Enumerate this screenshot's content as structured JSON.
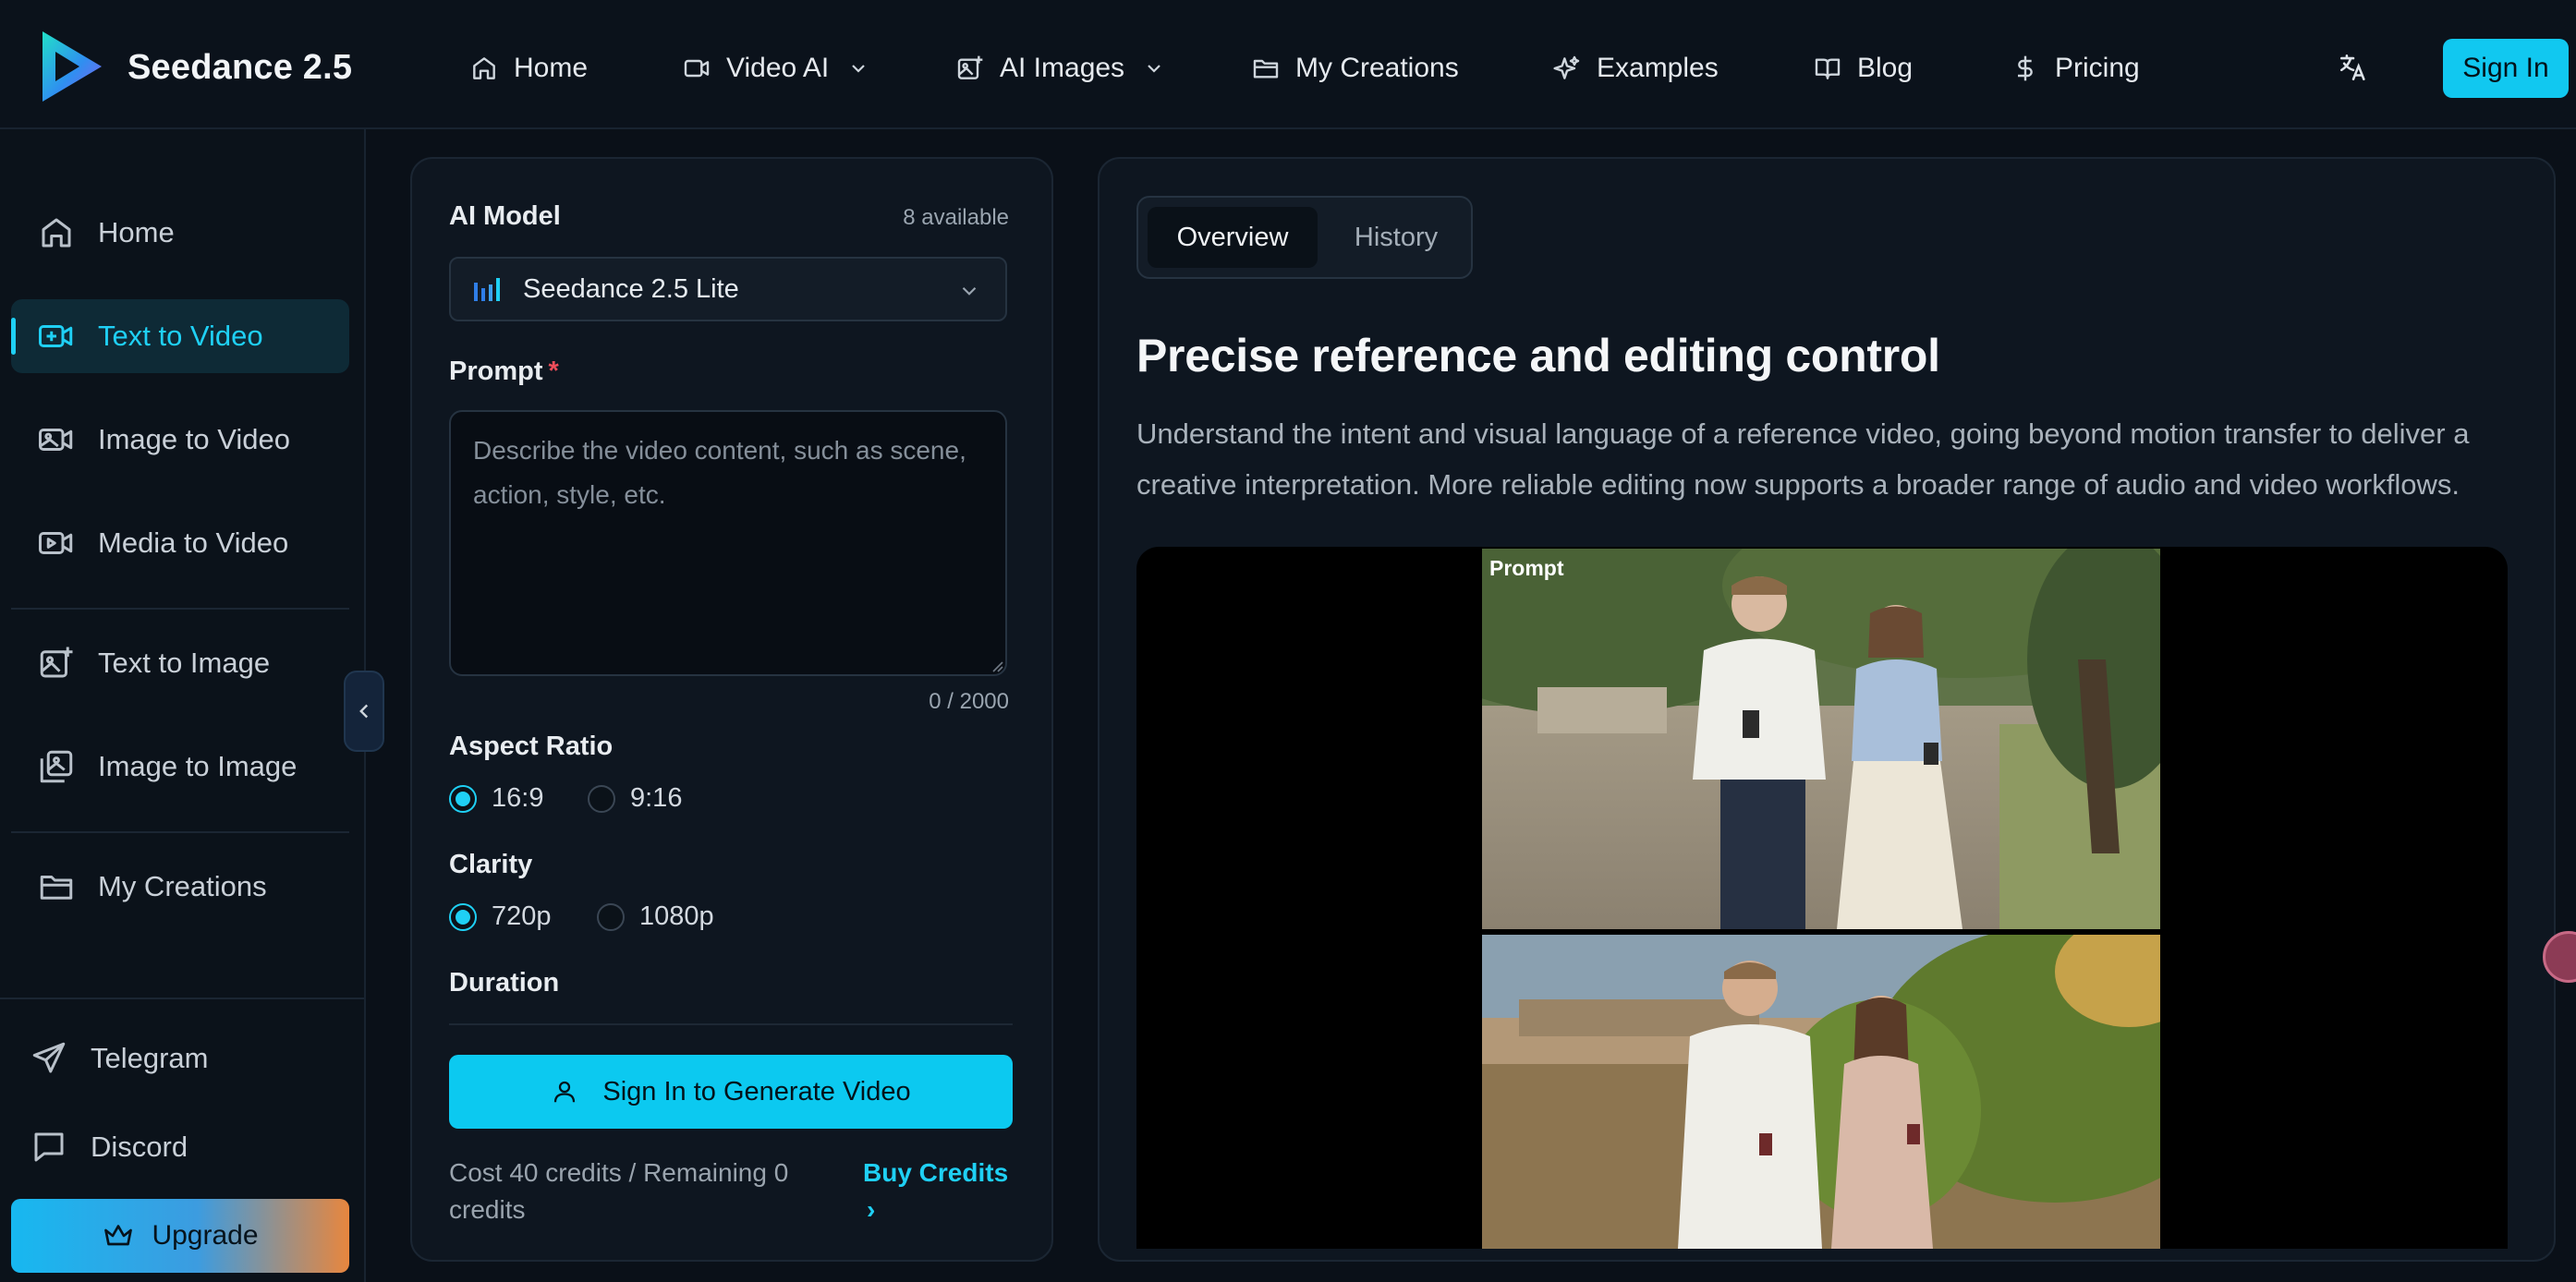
{
  "header": {
    "brand": "Seedance 2.5",
    "nav": [
      {
        "label": "Home",
        "icon": "home-icon"
      },
      {
        "label": "Video AI",
        "icon": "video-camera-icon",
        "dropdown": true
      },
      {
        "label": "AI Images",
        "icon": "image-plus-icon",
        "dropdown": true
      },
      {
        "label": "My Creations",
        "icon": "folder-icon"
      },
      {
        "label": "Examples",
        "icon": "sparkles-icon"
      },
      {
        "label": "Blog",
        "icon": "book-icon"
      },
      {
        "label": "Pricing",
        "icon": "dollar-icon"
      }
    ],
    "language_icon": "translate-icon",
    "sign_in": "Sign In"
  },
  "sidebar": {
    "items": [
      {
        "label": "Home",
        "icon": "home-icon"
      },
      {
        "label": "Text to Video",
        "icon": "video-plus-icon",
        "active": true
      },
      {
        "label": "Image to Video",
        "icon": "image-video-icon"
      },
      {
        "label": "Media to Video",
        "icon": "media-video-icon"
      },
      {
        "label": "Text to Image",
        "icon": "image-sparkle-icon"
      },
      {
        "label": "Image to Image",
        "icon": "images-icon"
      },
      {
        "label": "My Creations",
        "icon": "folder-icon"
      }
    ],
    "links": [
      {
        "label": "Telegram",
        "icon": "send-icon"
      },
      {
        "label": "Discord",
        "icon": "chat-icon"
      }
    ],
    "upgrade": "Upgrade"
  },
  "form": {
    "model_label": "AI Model",
    "model_available": "8 available",
    "model_selected": "Seedance 2.5 Lite",
    "prompt_label": "Prompt",
    "prompt_required": "*",
    "prompt_placeholder": "Describe the video content, such as scene, action, style, etc.",
    "prompt_value": "",
    "prompt_counter": "0 / 2000",
    "aspect_label": "Aspect Ratio",
    "aspect_options": [
      "16:9",
      "9:16"
    ],
    "aspect_selected": "16:9",
    "clarity_label": "Clarity",
    "clarity_options": [
      "720p",
      "1080p"
    ],
    "clarity_selected": "720p",
    "duration_label": "Duration",
    "generate_button": "Sign In to Generate Video",
    "cost_text": "Cost 40 credits / Remaining 0 credits",
    "buy_credits": "Buy Credits",
    "buy_chevron": "›"
  },
  "content": {
    "tabs": [
      {
        "label": "Overview",
        "active": true
      },
      {
        "label": "History",
        "active": false
      }
    ],
    "title": "Precise reference and editing control",
    "description": "Understand the intent and visual language of a reference video, going beyond motion transfer to deliver a creative interpretation. More reliable editing now supports a broader range of audio and video workflows.",
    "video_label": "Prompt"
  },
  "colors": {
    "accent": "#1fd0f5",
    "button": "#0cc9f0",
    "background": "#0a1018",
    "panel": "#0e1620",
    "required": "#ef4d5a"
  }
}
